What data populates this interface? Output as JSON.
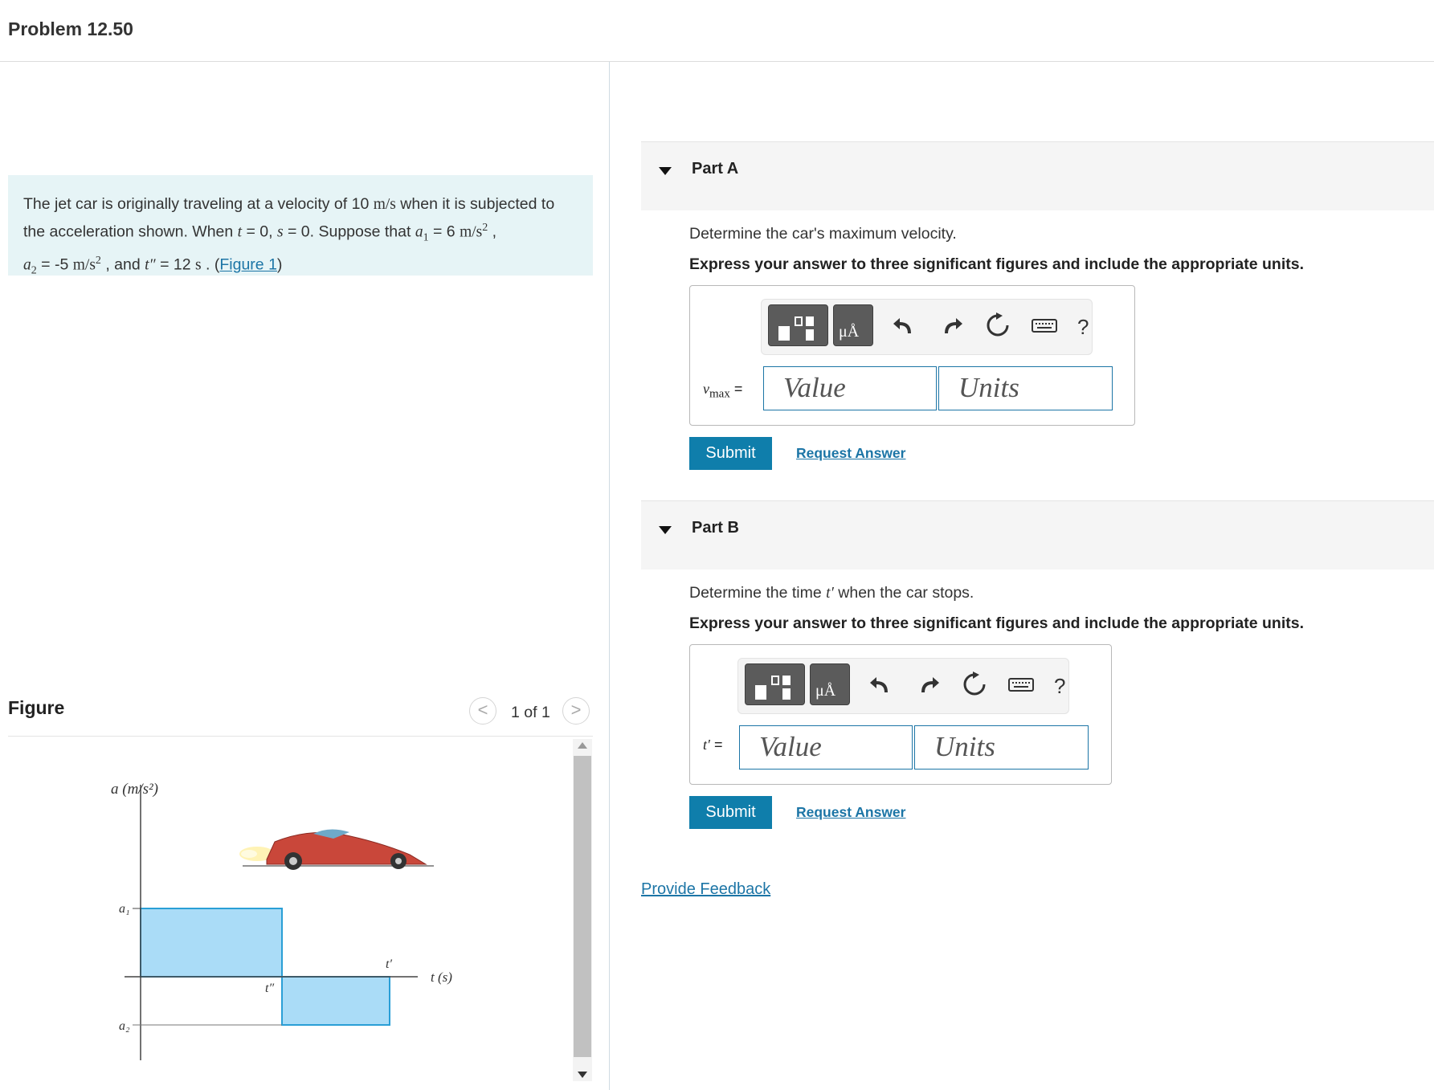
{
  "header": {
    "title": "Problem 12.50"
  },
  "problem": {
    "text_1": "The jet car is originally traveling at a velocity of 10 ",
    "unit_ms": "m/s",
    "text_2": " when it is subjected to the acceleration shown. When ",
    "t_var": "t",
    "text_3": " = 0, ",
    "s_var": "s",
    "text_4": " = 0. Suppose that ",
    "a1_var": "a",
    "a1_sub": "1",
    "text_5": " = 6 ",
    "unit_ms2": "m/s",
    "sq": "2",
    "text_6": " ,",
    "a2_var": "a",
    "a2_sub": "2",
    "text_7": " = -5 ",
    "text_8": " , and ",
    "tpp_var": "t″",
    "text_9": " = 12 ",
    "unit_s": "s",
    "text_10": " . (",
    "figure_link": "Figure 1",
    "text_11": ")"
  },
  "figure": {
    "label": "Figure",
    "count": "1 of 1",
    "prev": "<",
    "next": ">",
    "y_axis_label": "a (m/s²)",
    "x_axis_label": "t (s)",
    "a1_label": "a₁",
    "a2_label": "a₂",
    "tpp_label": "t″",
    "tp_label": "t′",
    "colors": {
      "fill": "#aadcf7",
      "stroke": "#2a9fd6",
      "car": "#c9473a"
    }
  },
  "parts": [
    {
      "label": "Part A",
      "question": "Determine the car's maximum velocity.",
      "instruction": "Express your answer to three significant figures and include the appropriate units.",
      "var_main": "v",
      "var_sub": "max",
      "eq": "=",
      "value_placeholder": "Value",
      "units_placeholder": "Units",
      "submit": "Submit",
      "request": "Request Answer"
    },
    {
      "label": "Part B",
      "question_1": "Determine the time ",
      "question_var": "t′",
      "question_2": " when the car stops.",
      "instruction": "Express your answer to three significant figures and include the appropriate units.",
      "var_main": "t′",
      "eq": "=",
      "value_placeholder": "Value",
      "units_placeholder": "Units",
      "submit": "Submit",
      "request": "Request Answer"
    }
  ],
  "toolbar": {
    "units_glyph": "μÅ",
    "help": "?",
    "icons": [
      "templates-icon",
      "units-icon",
      "undo-icon",
      "redo-icon",
      "reset-icon",
      "keyboard-icon",
      "help-icon"
    ]
  },
  "feedback": "Provide Feedback"
}
